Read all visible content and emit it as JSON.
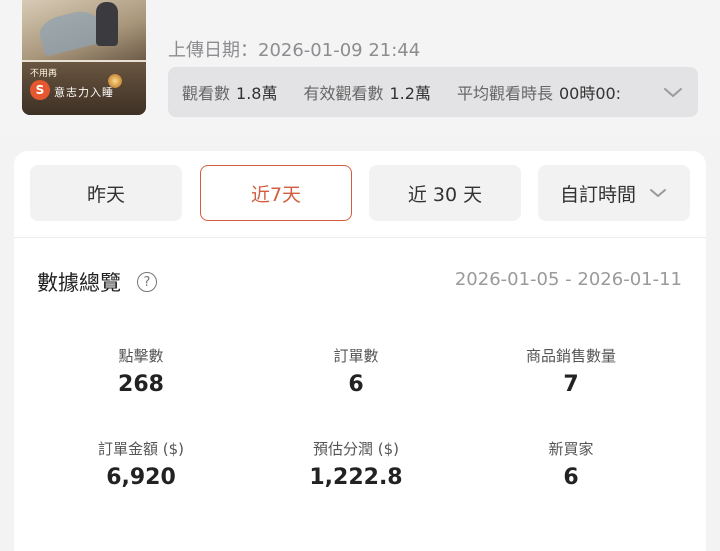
{
  "video": {
    "thumbnail": {
      "small_text": "不用再",
      "caption": "意志力入睡",
      "brand_icon": "shopee-s-icon"
    },
    "upload_label": "上傳日期：",
    "upload_date": "2026-01-09 21:44",
    "stats": [
      {
        "label": "觀看數",
        "value": "1.8萬"
      },
      {
        "label": "有效觀看數",
        "value": "1.2萬"
      },
      {
        "label": "平均觀看時長",
        "value": "00時00:"
      }
    ]
  },
  "range_tabs": [
    {
      "label": "昨天",
      "active": false
    },
    {
      "label": "近7天",
      "active": true
    },
    {
      "label": "近 30 天",
      "active": false
    },
    {
      "label": "自訂時間",
      "active": false
    }
  ],
  "overview": {
    "title": "數據總覽",
    "help_icon": "?",
    "date_range": "2026-01-05 - 2026-01-11"
  },
  "metrics": [
    {
      "label": "點擊數",
      "value": "268"
    },
    {
      "label": "訂單數",
      "value": "6"
    },
    {
      "label": "商品銷售數量",
      "value": "7"
    },
    {
      "label": "訂單金額 ($)",
      "value": "6,920"
    },
    {
      "label": "預估分潤 ($)",
      "value": "1,222.8"
    },
    {
      "label": "新買家",
      "value": "6"
    }
  ],
  "colors": {
    "accent": "#d25d3f",
    "background": "#f3f3f4",
    "card": "#ffffff"
  }
}
